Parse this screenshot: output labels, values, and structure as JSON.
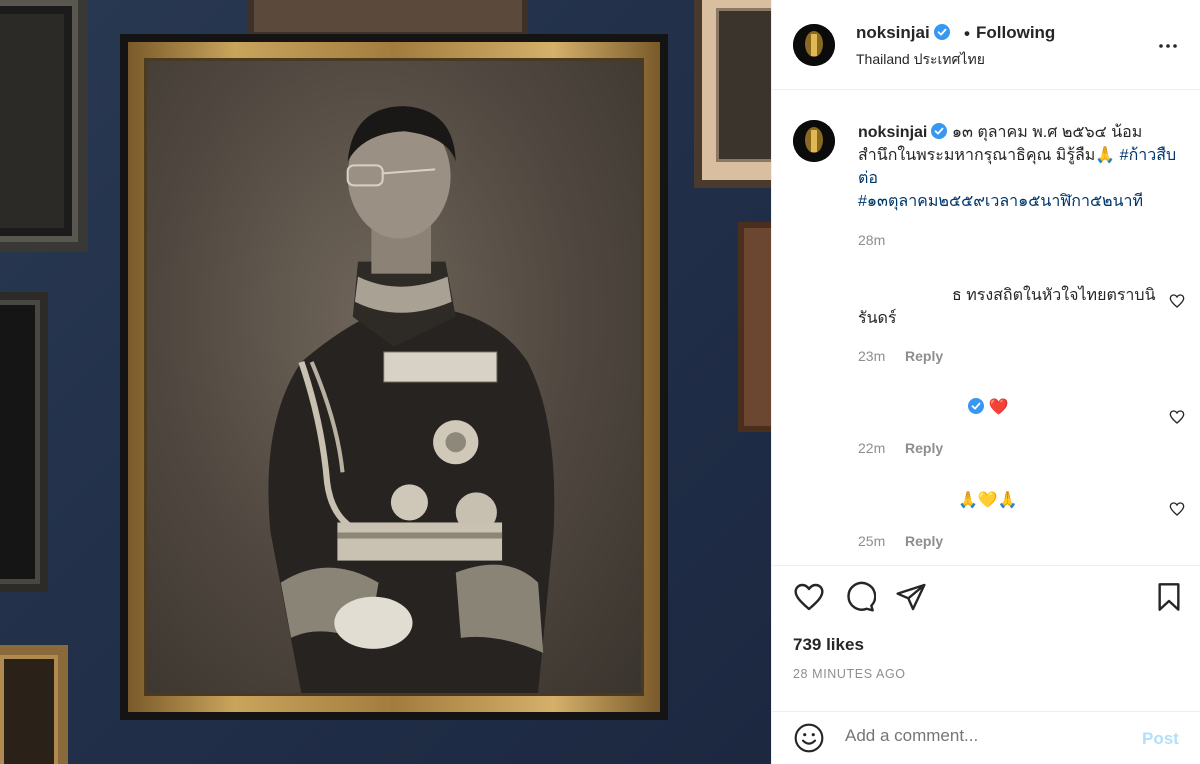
{
  "header": {
    "username": "noksinjai",
    "separator": "•",
    "follow_status": "Following",
    "location": "Thailand ประเทศไทย"
  },
  "caption": {
    "username": "noksinjai",
    "text": "๑๓ ตุลาคม พ.ศ ๒๕๖๔ น้อมสำนึกในพระมหากรุณาธิคุณ มิรู้ลืม🙏",
    "hashtag1": "#ก้าวสืบต่อ",
    "hashtag2": "#๑๓ตุลาคม๒๕๕๙เวลา๑๕นาฬิกา๕๒นาที",
    "time": "28m"
  },
  "comments": [
    {
      "text": "ธ ทรงสถิตในหัวใจไทยตราบนิรันดร์",
      "time": "23m",
      "reply": "Reply"
    },
    {
      "text": "❤️",
      "time": "22m",
      "reply": "Reply"
    },
    {
      "text": "🙏💛🙏",
      "time": "25m",
      "reply": "Reply"
    }
  ],
  "stats": {
    "likes": "739 likes",
    "posted": "28 MINUTES AGO"
  },
  "composer": {
    "placeholder": "Add a comment...",
    "post_label": "Post"
  },
  "icons": {
    "more": "more-options-icon",
    "like": "heart-icon",
    "comment": "comment-icon",
    "share": "share-icon",
    "save": "bookmark-icon",
    "emoji": "emoji-icon",
    "verified": "verified-badge-icon"
  },
  "colors": {
    "link": "#00376b",
    "verified": "#3897f0",
    "muted": "#8e8e8e",
    "post_disabled": "#b2dffc"
  }
}
